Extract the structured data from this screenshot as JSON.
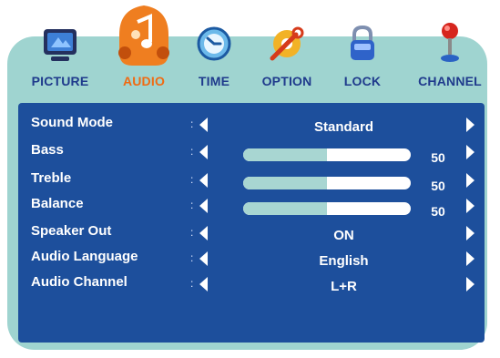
{
  "tabs": [
    {
      "label": "PICTURE",
      "icon": "monitor-icon",
      "active": false
    },
    {
      "label": "AUDIO",
      "icon": "music-note-icon",
      "active": true
    },
    {
      "label": "TIME",
      "icon": "clock-icon",
      "active": false
    },
    {
      "label": "OPTION",
      "icon": "wrench-icon",
      "active": false
    },
    {
      "label": "LOCK",
      "icon": "padlock-icon",
      "active": false
    },
    {
      "label": "CHANNEL",
      "icon": "antenna-icon",
      "active": false
    }
  ],
  "menu": [
    {
      "label": "Sound Mode",
      "sep": ":",
      "value": "Standard"
    },
    {
      "label": "Bass",
      "sep": ":",
      "value": "50",
      "level": 0.5
    },
    {
      "label": "Treble",
      "sep": ":",
      "value": "50",
      "level": 0.5
    },
    {
      "label": "Balance",
      "sep": ":",
      "value": "50",
      "level": 0.5
    },
    {
      "label": "Speaker Out",
      "sep": ":",
      "value": "ON"
    },
    {
      "label": "Audio Language",
      "sep": ":",
      "value": "English"
    },
    {
      "label": "Audio Channel",
      "sep": ":",
      "value": "L+R"
    }
  ],
  "colors": {
    "panel": "#9fd4d0",
    "content": "#1d4f9c",
    "tab_label": "#1f3a8c",
    "tab_active": "#f06a12",
    "slider_fill": "#a8d6d2",
    "slider_track": "#ffffff"
  }
}
